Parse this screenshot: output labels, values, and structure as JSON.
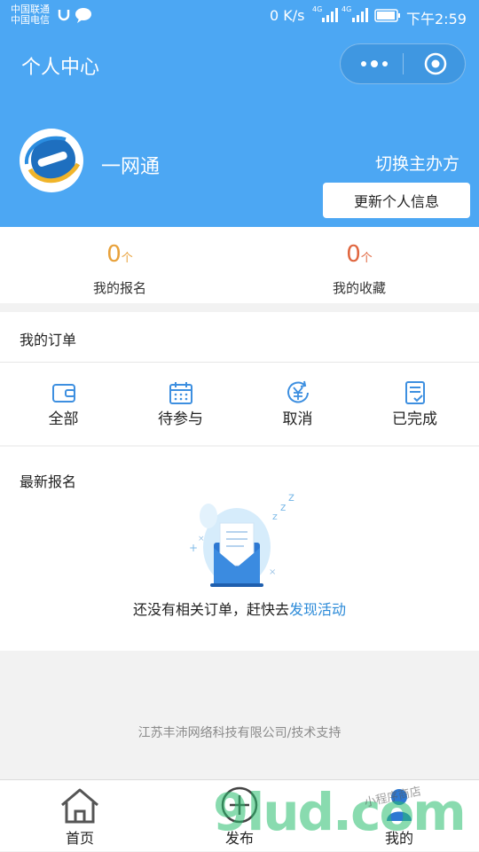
{
  "status_bar": {
    "carrier1": "中国联通",
    "carrier2": "中国电信",
    "speed": "0 K/s",
    "net1": "4G",
    "net2": "4G",
    "time": "下午2:59"
  },
  "header": {
    "title": "个人中心",
    "username": "一网通",
    "switch_label": "切换主办方",
    "update_label": "更新个人信息"
  },
  "stats": [
    {
      "value": "0",
      "unit": "个",
      "label": "我的报名",
      "color": "#e8a13a"
    },
    {
      "value": "0",
      "unit": "个",
      "label": "我的收藏",
      "color": "#e0663f"
    }
  ],
  "orders": {
    "title": "我的订单",
    "items": [
      {
        "label": "全部",
        "icon": "wallet-icon"
      },
      {
        "label": "待参与",
        "icon": "calendar-icon"
      },
      {
        "label": "取消",
        "icon": "refund-icon"
      },
      {
        "label": "已完成",
        "icon": "checklist-icon"
      }
    ]
  },
  "latest": {
    "title": "最新报名",
    "empty_text": "还没有相关订单，赶快去",
    "empty_link": "发现活动"
  },
  "footer": "江苏丰沛网络科技有限公司/技术支持",
  "tabs": [
    {
      "label": "首页",
      "icon": "home-icon"
    },
    {
      "label": "发布",
      "icon": "add-icon"
    },
    {
      "label": "我的",
      "icon": "user-icon"
    }
  ],
  "watermark": {
    "brand": "9lud.com",
    "shop": "小程序商店"
  },
  "colors": {
    "primary": "#4ca7f3",
    "link": "#2b8ad8"
  }
}
